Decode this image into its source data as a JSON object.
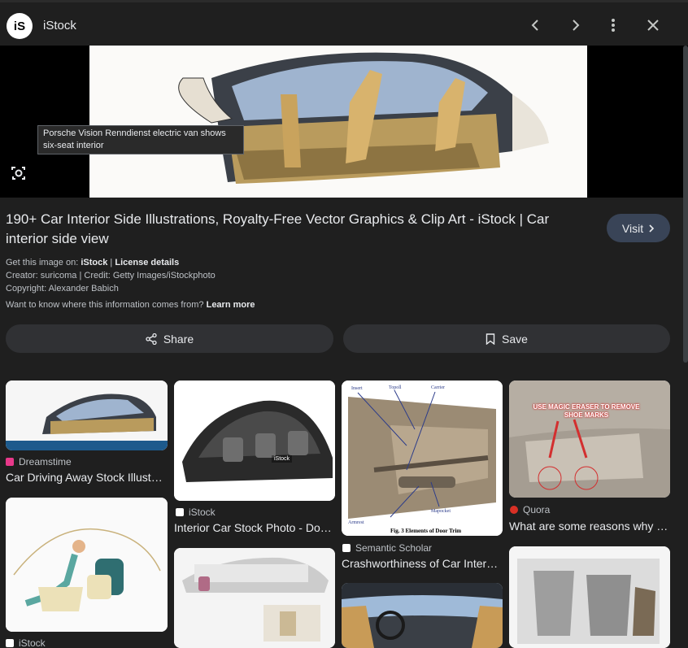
{
  "header": {
    "logo_text": "iS",
    "site_name": "iStock",
    "icons": [
      "chevron-left-icon",
      "chevron-right-icon",
      "more-vert-icon",
      "close-icon"
    ]
  },
  "preview": {
    "caption": "Porsche Vision Renndienst electric van shows six-seat interior"
  },
  "info": {
    "title": "190+ Car Interior Side Illustrations, Royalty-Free Vector Graphics & Clip Art - iStock | Car interior side view",
    "visit_label": "Visit",
    "get_image_prefix": "Get this image on:",
    "get_image_source": "iStock",
    "license_details": "License details",
    "creator_line": "Creator: suricoma | Credit: Getty Images/iStockphoto",
    "copyright_line": "Copyright: Alexander Babich",
    "info_question": "Want to know where this information comes from?",
    "learn_more": "Learn more",
    "share_label": "Share",
    "save_label": "Save"
  },
  "results": [
    {
      "source": "Dreamstime",
      "caption": "Car Driving Away Stock Illust…",
      "source_color": "#e8398a"
    },
    {
      "source": "iStock",
      "caption": "Interior Car Stock Photo - Do…",
      "source_color": "#ffffff",
      "watermark": "iStock"
    },
    {
      "source": "Semantic Scholar",
      "caption": "Crashworthiness of Car Inter…",
      "source_color": "#ffffff",
      "figure_caption": "Fig. 3 Elements of Door Trim",
      "labels": [
        "Insert",
        "Topoll",
        "Carrier",
        "Armrest",
        "Mapocket"
      ]
    },
    {
      "source": "Quora",
      "caption": "What are some reasons why …",
      "source_color": "#d93025",
      "overlay_text": "USE MAGIC ERASER TO REMOVE SHOE MARKS"
    },
    {
      "source": "iStock",
      "caption": "",
      "source_color": "#ffffff"
    }
  ]
}
